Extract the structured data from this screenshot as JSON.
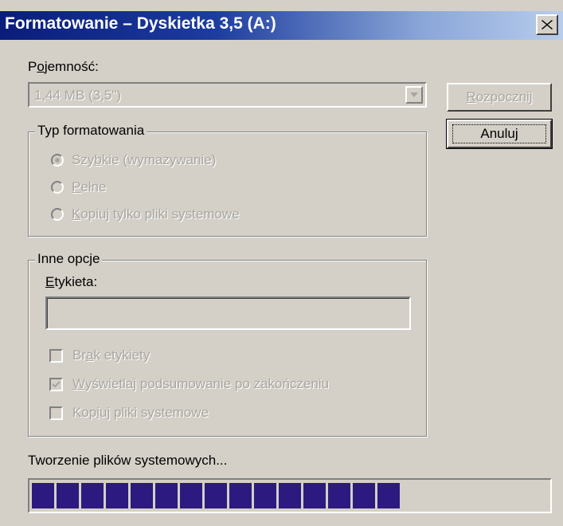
{
  "window": {
    "title": "Formatowanie – Dyskietka 3,5 (A:)"
  },
  "capacity": {
    "label_pre": "P",
    "label_u": "o",
    "label_post": "jemność:",
    "value": "1,44 MB (3,5\")"
  },
  "buttons": {
    "start": {
      "label_u": "R",
      "label_post": "ozpocznij",
      "enabled": false
    },
    "cancel": {
      "label": "Anuluj"
    }
  },
  "format_type": {
    "legend": "Typ formatowania",
    "options": [
      {
        "pre": "Szy",
        "u": "b",
        "post": "kie (wymazywanie)",
        "checked": true
      },
      {
        "pre": "",
        "u": "P",
        "post": "ełne",
        "checked": false
      },
      {
        "pre": "",
        "u": "K",
        "post": "opiuj tylko pliki systemowe",
        "checked": false
      }
    ]
  },
  "other_options": {
    "legend": "Inne opcje",
    "label_field": {
      "label_u": "E",
      "label_post": "tykieta:",
      "value": ""
    },
    "checkboxes": [
      {
        "pre": "Br",
        "u": "a",
        "post": "k etykiety",
        "checked": false
      },
      {
        "pre": "",
        "u": "W",
        "post": "yświetlaj podsumowanie po zakończeniu",
        "checked": true
      },
      {
        "pre": "Kop",
        "u": "i",
        "post": "uj pliki systemowe",
        "checked": false
      }
    ]
  },
  "status": {
    "text": "Tworzenie plików systemowych...",
    "progress_percent": 70
  }
}
